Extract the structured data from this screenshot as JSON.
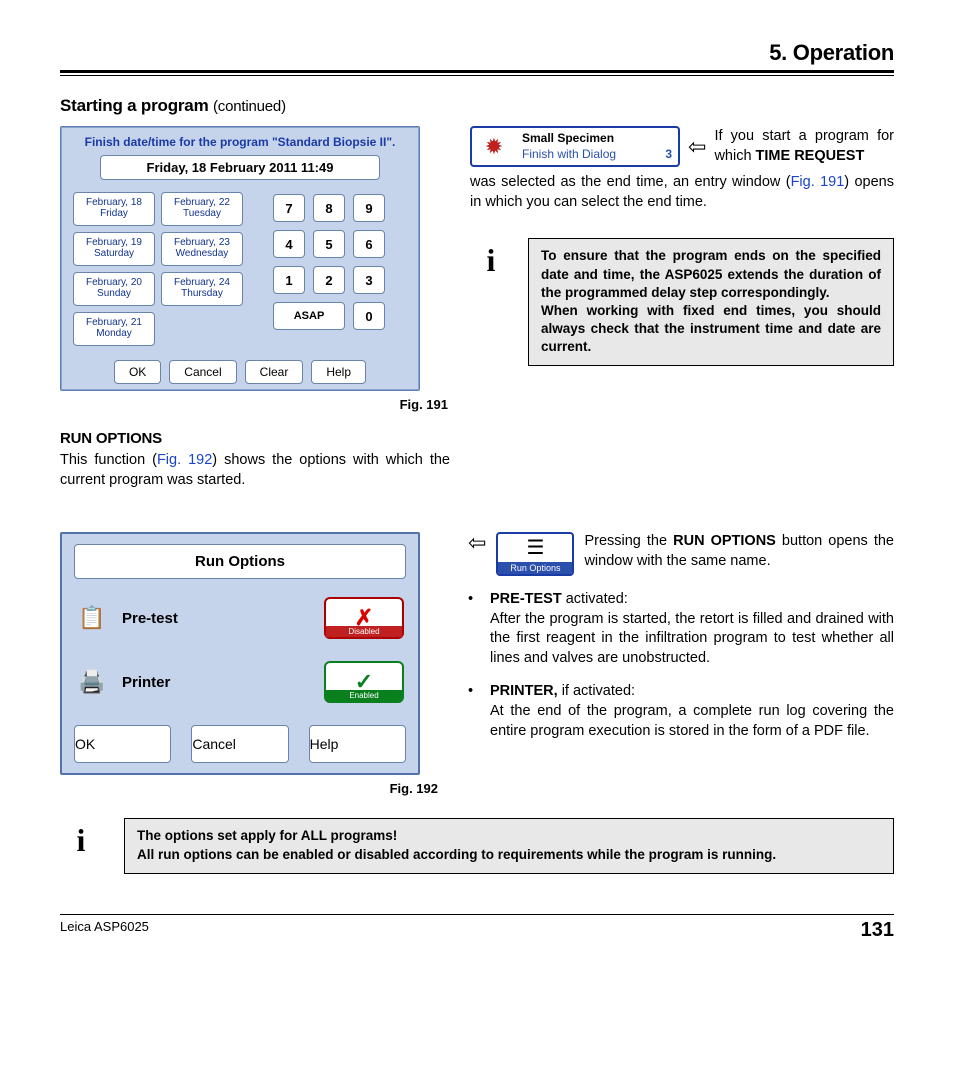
{
  "header": {
    "section": "5.    Operation"
  },
  "start_heading": {
    "main": "Starting a program",
    "cont": "(continued)"
  },
  "fig191": {
    "title": "Finish date/time for the program \"Standard Biopsie II\".",
    "dateband": "Friday, 18 February 2011       11:49",
    "dates": [
      {
        "ln1": "February, 18",
        "ln2": "Friday"
      },
      {
        "ln1": "February, 22",
        "ln2": "Tuesday"
      },
      {
        "ln1": "February, 19",
        "ln2": "Saturday"
      },
      {
        "ln1": "February, 23",
        "ln2": "Wednesday"
      },
      {
        "ln1": "February, 20",
        "ln2": "Sunday"
      },
      {
        "ln1": "February, 24",
        "ln2": "Thursday"
      },
      {
        "ln1": "February, 21",
        "ln2": "Monday"
      }
    ],
    "numpad": [
      "7",
      "8",
      "9",
      "4",
      "5",
      "6",
      "1",
      "2",
      "3"
    ],
    "asap": "ASAP",
    "zero": "0",
    "buttons": {
      "ok": "OK",
      "cancel": "Cancel",
      "clear": "Clear",
      "help": "Help"
    },
    "caption": "Fig. 191"
  },
  "pgm_chip": {
    "arrow": "⇦",
    "line1": "Small Specimen",
    "line2": "Finish with Dialog",
    "count": "3"
  },
  "right_para1": {
    "pre": "If you start a pro­gram for which ",
    "bold": "TIME REQUEST",
    "mid": " was selected as the end time, an entry window (",
    "figref": "Fig. 191",
    "post": ") opens in which you can select the end time."
  },
  "info1": "To ensure that the program ends on the speci­fied date and time, the ASP6025 extends the duration of the programmed delay step cor­respondingly.\nWhen working with fixed end times, you should always check that the instrument time and date are current.",
  "runopts_h": "RUN OPTIONS",
  "runopts_p": {
    "pre": "This function (",
    "figref": "Fig. 192",
    "post": ") shows the options with which the current program was started."
  },
  "fig192": {
    "title": "Run Options",
    "rows": [
      {
        "label": "Pre-test",
        "state": "Disabled"
      },
      {
        "label": "Printer",
        "state": "Enabled"
      }
    ],
    "buttons": {
      "ok": "OK",
      "cancel": "Cancel",
      "help": "Help"
    },
    "caption": "Fig. 192"
  },
  "runopt_btn": {
    "arrow": "⇦",
    "label": "Run Options"
  },
  "right_para2": {
    "pre": "Pressing the ",
    "bold": "RUN OPTIONS",
    "post": " button opens the window with the same name."
  },
  "bullets": [
    {
      "head": "PRE-TEST",
      "headtail": " activated:",
      "body": "After the program is started, the retort is filled and drained with the first reagent in the infiltration program to test whether all lines and valves are unobstructed."
    },
    {
      "head": "PRINTER,",
      "headtail": " if activated:",
      "body": "At the end of the program, a complete run log covering the entire program execution is stored in the form of a PDF file."
    }
  ],
  "info2": "The options set apply for ALL programs!\nAll run options can be enabled or disabled according to requirements while the program is running.",
  "footer": {
    "left": "Leica ASP6025",
    "page": "131"
  }
}
